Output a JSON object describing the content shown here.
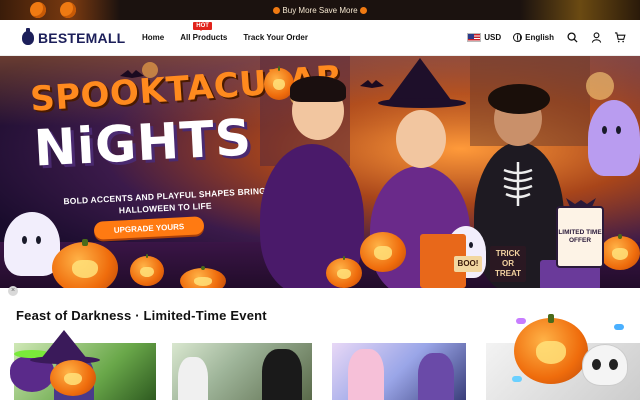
{
  "promo": {
    "text": "Buy More Save More"
  },
  "header": {
    "logo": "BESTEMALL",
    "nav": [
      {
        "label": "Home"
      },
      {
        "label": "All Products",
        "badge": "HOT"
      },
      {
        "label": "Track Your Order"
      }
    ],
    "currency": "USD",
    "language": "English",
    "icons": [
      "search-icon",
      "user-icon",
      "cart-icon"
    ]
  },
  "hero": {
    "title_line1": "SPOOKTACULAR",
    "title_line2": "NiGHTS",
    "subtitle": "BOLD ACCENTS AND PLAYFUL SHAPES BRING HALLOWEEN TO LIFE",
    "cta": "UPGRADE YOURS",
    "badge": "LIMITED TIME OFFER",
    "sign_1": "TRICK OR TREAT",
    "sign_2": "BOO!"
  },
  "section": {
    "title": "Feast of Darkness · Limited-Time Event"
  },
  "colors": {
    "brand": "#1c1f5a",
    "accent": "#ff7a12",
    "hot": "#e1231b"
  }
}
